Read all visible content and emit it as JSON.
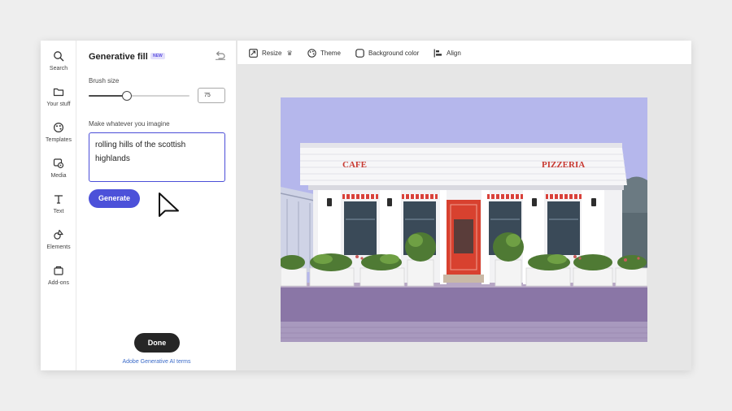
{
  "rail": {
    "items": [
      {
        "label": "Search",
        "icon": "search-icon"
      },
      {
        "label": "Your stuff",
        "icon": "folder-icon"
      },
      {
        "label": "Templates",
        "icon": "templates-icon"
      },
      {
        "label": "Media",
        "icon": "media-icon"
      },
      {
        "label": "Text",
        "icon": "text-icon"
      },
      {
        "label": "Elements",
        "icon": "elements-icon"
      },
      {
        "label": "Add-ons",
        "icon": "addons-icon"
      }
    ]
  },
  "panel": {
    "title": "Generative fill",
    "badge": "NEW",
    "brush_label": "Brush size",
    "brush_value": "75",
    "brush_level": 0.38,
    "prompt_label": "Make whatever you imagine",
    "prompt_text": "rolling hills of the scottish highlands",
    "generate_label": "Generate",
    "done_label": "Done",
    "terms_label": "Adobe Generative AI terms"
  },
  "toolbar": {
    "resize_label": "Resize",
    "theme_label": "Theme",
    "background_label": "Background color",
    "align_label": "Align"
  },
  "canvas": {
    "sign_left": "CAFE",
    "sign_right": "PIZZERIA"
  },
  "colors": {
    "accent": "#4c51d9",
    "done": "#262626",
    "sky_fill": "#b5b7ec"
  }
}
